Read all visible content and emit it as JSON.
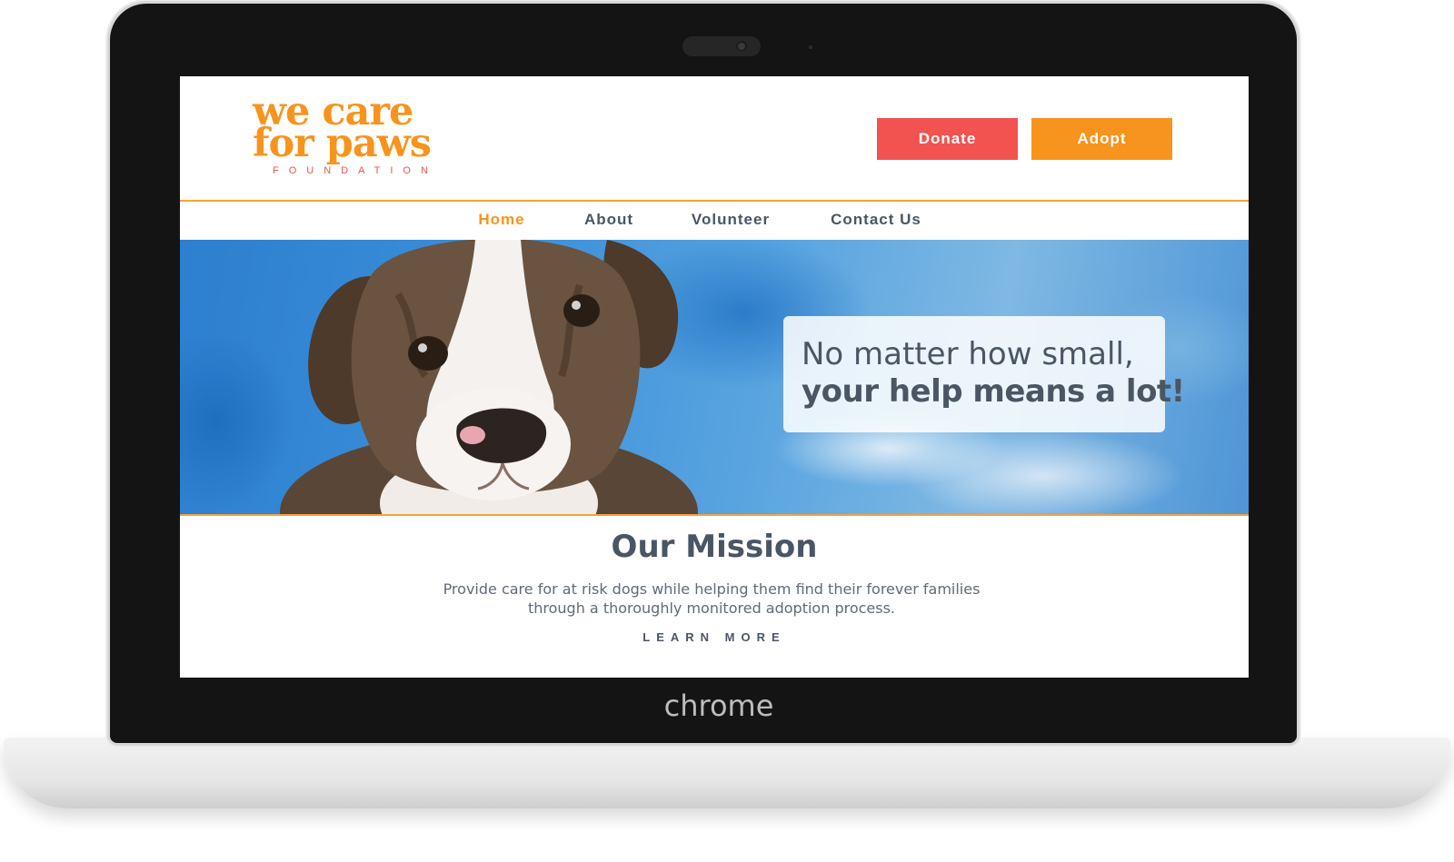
{
  "device": {
    "brand_label": "chrome"
  },
  "site": {
    "logo": {
      "line1": "we care",
      "line2": "for paws",
      "subtitle": "FOUNDATION"
    },
    "header_buttons": {
      "donate_label": "Donate",
      "adopt_label": "Adopt"
    },
    "nav": {
      "items": [
        {
          "label": "Home",
          "active": true
        },
        {
          "label": "About",
          "active": false
        },
        {
          "label": "Volunteer",
          "active": false
        },
        {
          "label": "Contact Us",
          "active": false
        }
      ]
    },
    "hero": {
      "line1": "No matter how small,",
      "line2": "your help means a lot!"
    },
    "mission": {
      "title": "Our Mission",
      "text": "Provide care for at risk dogs while helping them find their forever families through a thoroughly monitored adoption process.",
      "cta": "LEARN MORE"
    },
    "colors": {
      "orange": "#f7941d",
      "red": "#f25250",
      "slate": "#4a5664"
    }
  }
}
